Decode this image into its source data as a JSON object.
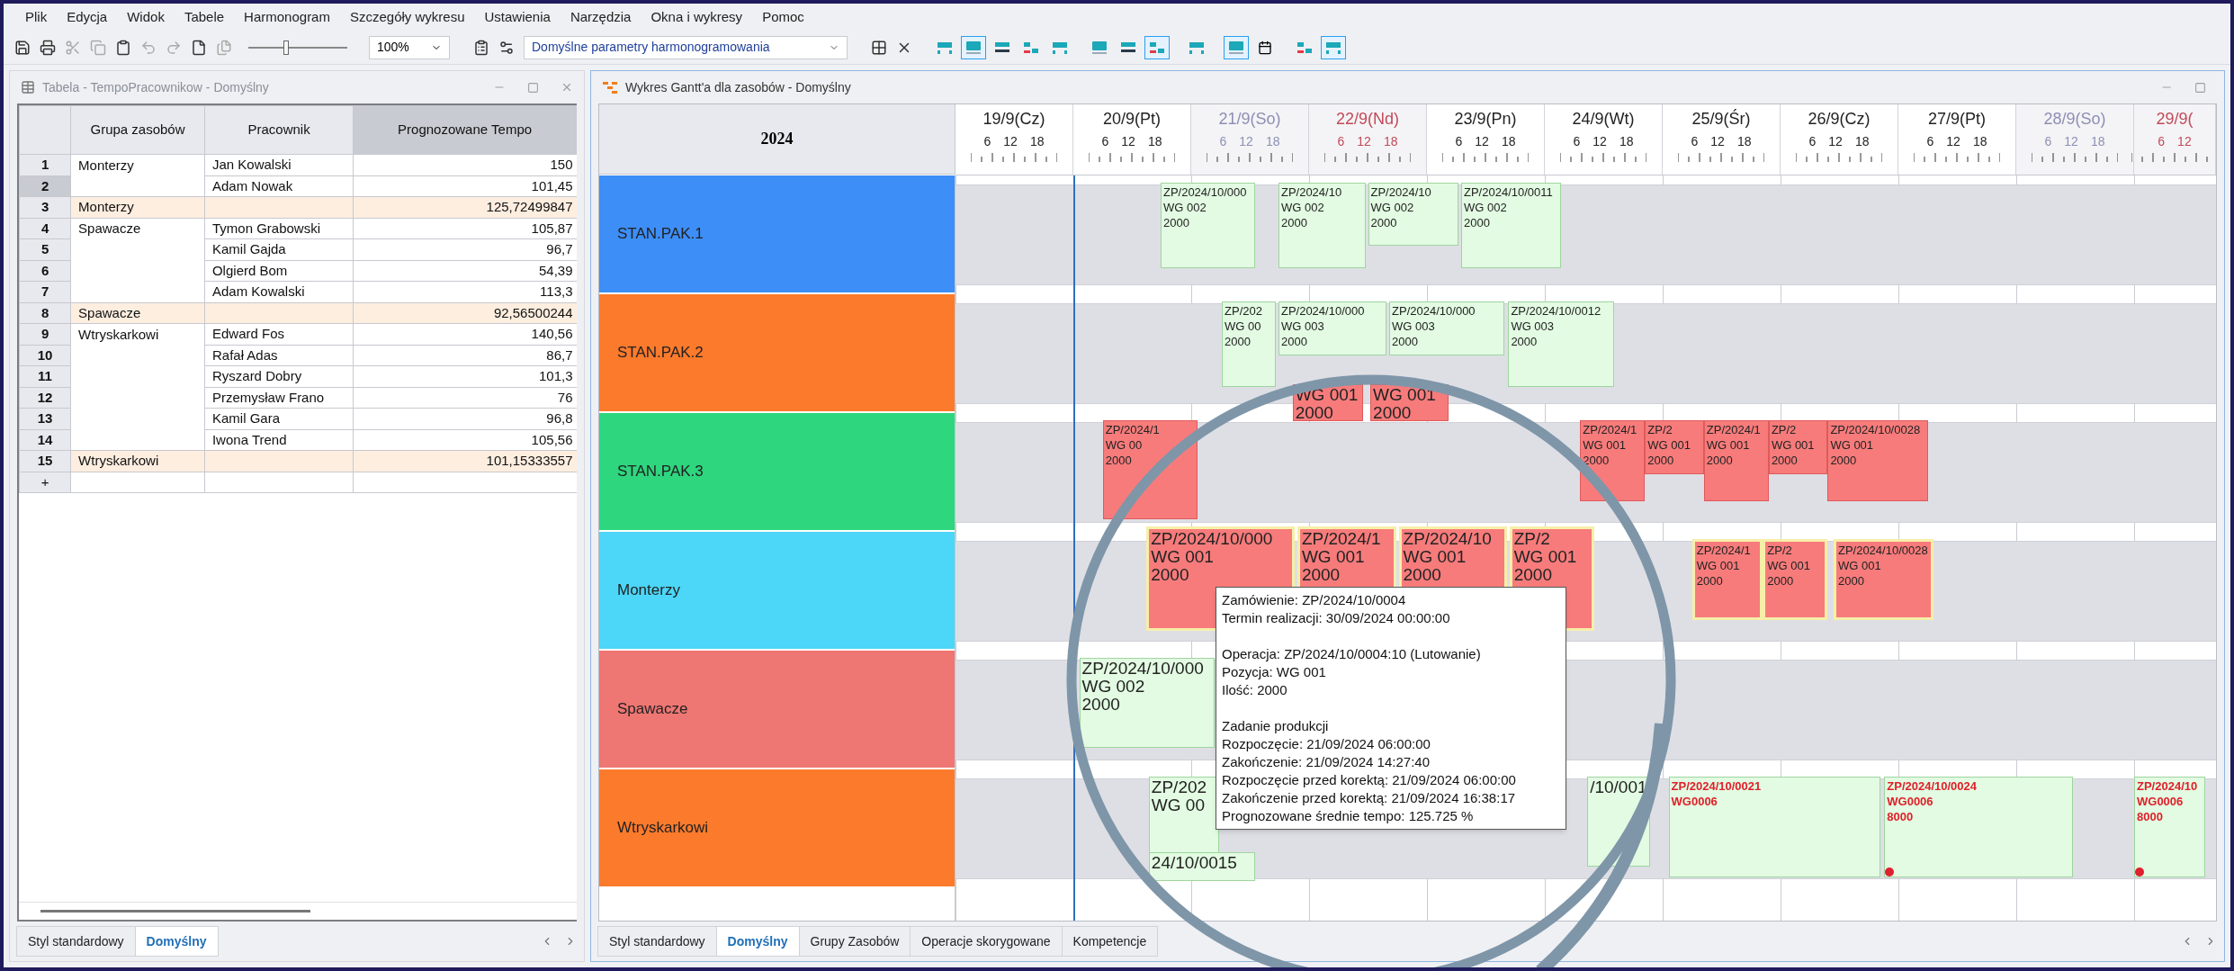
{
  "menu": [
    "Plik",
    "Edycja",
    "Widok",
    "Tabele",
    "Harmonogram",
    "Szczegóły wykresu",
    "Ustawienia",
    "Narzędzia",
    "Okna i wykresy",
    "Pomoc"
  ],
  "toolbar": {
    "zoom_slider": {
      "level": 0.35
    },
    "zoom": "100%",
    "profile": "Domyślne parametry harmonogramowania",
    "view_buttons": [
      {
        "selected": false
      },
      {
        "selected": true
      },
      {
        "selected": false
      },
      {
        "selected": false
      },
      {
        "selected": false
      },
      {
        "selected": false
      },
      {
        "selected": false
      },
      {
        "selected": true
      },
      {
        "selected": false
      },
      {
        "selected": true
      },
      {
        "selected": false
      },
      {
        "selected": false
      },
      {
        "selected": true
      }
    ]
  },
  "table_window": {
    "title": "Tabela - TempoPracownikow - Domyślny",
    "columns": [
      "Grupa zasobów",
      "Pracownik",
      "Prognozowane Tempo"
    ],
    "rows": [
      {
        "num": "1",
        "group": "Monterzy",
        "worker": "Jan Kowalski",
        "tempo": "150",
        "kind": "worker",
        "selected": false
      },
      {
        "num": "2",
        "worker": "Adam Nowak",
        "tempo": "101,45",
        "kind": "worker",
        "selected": true
      },
      {
        "num": "3",
        "group": "Monterzy",
        "tempo": "125,72499847",
        "kind": "summary",
        "selected": false
      },
      {
        "num": "4",
        "group": "Spawacze",
        "worker": "Tymon Grabowski",
        "tempo": "105,87",
        "kind": "worker",
        "selected": false
      },
      {
        "num": "5",
        "worker": "Kamil Gajda",
        "tempo": "96,7",
        "kind": "worker",
        "selected": false
      },
      {
        "num": "6",
        "worker": "Olgierd Bom",
        "tempo": "54,39",
        "kind": "worker",
        "selected": false
      },
      {
        "num": "7",
        "worker": "Adam Kowalski",
        "tempo": "113,3",
        "kind": "worker",
        "selected": false
      },
      {
        "num": "8",
        "group": "Spawacze",
        "tempo": "92,56500244",
        "kind": "summary",
        "selected": false
      },
      {
        "num": "9",
        "group": "Wtryskarkowi",
        "worker": "Edward Fos",
        "tempo": "140,56",
        "kind": "worker",
        "selected": false
      },
      {
        "num": "10",
        "worker": "Rafał Adas",
        "tempo": "86,7",
        "kind": "worker",
        "selected": false
      },
      {
        "num": "11",
        "worker": "Ryszard Dobry",
        "tempo": "101,3",
        "kind": "worker",
        "selected": false
      },
      {
        "num": "12",
        "worker": "Przemysław Frano",
        "tempo": "76",
        "kind": "worker",
        "selected": false
      },
      {
        "num": "13",
        "worker": "Kamil Gara",
        "tempo": "96,8",
        "kind": "worker",
        "selected": false
      },
      {
        "num": "14",
        "worker": "Iwona Trend",
        "tempo": "105,56",
        "kind": "worker",
        "selected": false
      },
      {
        "num": "15",
        "group": "Wtryskarkowi",
        "tempo": "101,15333557",
        "kind": "summary",
        "selected": false
      }
    ],
    "new_row": "+",
    "tabs": [
      {
        "label": "Styl standardowy",
        "selected": false
      },
      {
        "label": "Domyślny",
        "selected": true
      }
    ]
  },
  "gantt_window": {
    "title": "Wykres Gantt'a dla zasobów - Domyślny",
    "year": "2024",
    "days": [
      {
        "label": "19/9(Cz)",
        "kind": "weekday",
        "hours": [
          "6",
          "12",
          "18"
        ]
      },
      {
        "label": "20/9(Pt)",
        "kind": "weekday",
        "hours": [
          "6",
          "12",
          "18"
        ]
      },
      {
        "label": "21/9(So)",
        "kind": "saturday",
        "hours": [
          "6",
          "12",
          "18"
        ]
      },
      {
        "label": "22/9(Nd)",
        "kind": "sunday",
        "hours": [
          "6",
          "12",
          "18"
        ]
      },
      {
        "label": "23/9(Pn)",
        "kind": "weekday",
        "hours": [
          "6",
          "12",
          "18"
        ]
      },
      {
        "label": "24/9(Wt)",
        "kind": "weekday",
        "hours": [
          "6",
          "12",
          "18"
        ]
      },
      {
        "label": "25/9(Śr)",
        "kind": "weekday",
        "hours": [
          "6",
          "12",
          "18"
        ]
      },
      {
        "label": "26/9(Cz)",
        "kind": "weekday",
        "hours": [
          "6",
          "12",
          "18"
        ]
      },
      {
        "label": "27/9(Pt)",
        "kind": "weekday",
        "hours": [
          "6",
          "12",
          "18"
        ]
      },
      {
        "label": "28/9(So)",
        "kind": "saturday",
        "hours": [
          "6",
          "12",
          "18"
        ]
      },
      {
        "label": "29/9(",
        "kind": "sunday",
        "hours": [
          "6",
          "12"
        ]
      }
    ],
    "resources": [
      {
        "name": "STAN.PAK.1",
        "color": "#3d8ef7",
        "bars": [
          {
            "lines": [
              "ZP/2024/10/000",
              "WG 002",
              "2000"
            ],
            "kind": "plan",
            "magnified": false
          },
          {
            "lines": [
              "ZP/2024/10",
              "WG 002",
              "2000"
            ],
            "kind": "plan",
            "magnified": false
          },
          {
            "lines": [
              "ZP/2024/10",
              "WG 002",
              "2000"
            ],
            "kind": "plan",
            "magnified": false
          },
          {
            "lines": [
              "ZP/2024/10/0011",
              "WG 002",
              "2000"
            ],
            "kind": "plan",
            "magnified": false
          }
        ]
      },
      {
        "name": "STAN.PAK.2",
        "color": "#fc7a2b",
        "bars": [
          {
            "lines": [
              "ZP/202",
              "WG 00",
              "2000"
            ],
            "kind": "plan",
            "magnified": false
          },
          {
            "lines": [
              "ZP/2024/10/000",
              "WG 003",
              "2000"
            ],
            "kind": "plan",
            "magnified": false
          },
          {
            "lines": [
              "ZP/2024/10/000",
              "WG 003",
              "2000"
            ],
            "kind": "plan",
            "magnified": false
          },
          {
            "lines": [
              "ZP/2024/10/0012",
              "WG 003",
              "2000"
            ],
            "kind": "plan",
            "magnified": false
          },
          {
            "lines": [
              "WG 001",
              "2000"
            ],
            "kind": "late",
            "magnified": true
          },
          {
            "lines": [
              "WG 001",
              "2000"
            ],
            "kind": "late",
            "magnified": true
          }
        ]
      },
      {
        "name": "STAN.PAK.3",
        "color": "#2ed67e",
        "bars": [
          {
            "lines": [
              "ZP/2024/1",
              "WG 00",
              "2000"
            ],
            "kind": "late",
            "magnified": false
          },
          {
            "lines": [
              "ZP/2024/1",
              "WG 001",
              "2000"
            ],
            "kind": "late",
            "magnified": false
          },
          {
            "lines": [
              "ZP/2",
              "WG 001",
              "2000"
            ],
            "kind": "late",
            "magnified": false
          },
          {
            "lines": [
              "ZP/2024/1",
              "WG 001",
              "2000"
            ],
            "kind": "late",
            "magnified": false
          },
          {
            "lines": [
              "ZP/2",
              "WG 001",
              "2000"
            ],
            "kind": "late",
            "magnified": false
          },
          {
            "lines": [
              "ZP/2024/10/0028",
              "WG 001",
              "2000"
            ],
            "kind": "late",
            "magnified": false
          }
        ]
      },
      {
        "name": "Monterzy",
        "color": "#4cd6f7",
        "bars": [
          {
            "lines": [
              "ZP/2024/10/000",
              "WG 001",
              "2000"
            ],
            "kind": "late_selected",
            "magnified": true
          },
          {
            "lines": [
              "ZP/2024/1",
              "WG 001",
              "2000"
            ],
            "kind": "late_selected",
            "magnified": true
          },
          {
            "lines": [
              "ZP/2024/10",
              "WG 001",
              "2000"
            ],
            "kind": "late_selected",
            "magnified": true
          },
          {
            "lines": [
              "ZP/2",
              "WG 001",
              "2000"
            ],
            "kind": "late_selected",
            "magnified": true
          },
          {
            "lines": [
              "ZP/2024/1",
              "WG 001",
              "2000"
            ],
            "kind": "late_selected",
            "magnified": false
          },
          {
            "lines": [
              "ZP/2",
              "WG 001",
              "2000"
            ],
            "kind": "late_selected",
            "magnified": false
          },
          {
            "lines": [
              "ZP/2024/10/0028",
              "WG 001",
              "2000"
            ],
            "kind": "late_selected",
            "magnified": false
          }
        ]
      },
      {
        "name": "Spawacze",
        "color": "#ee7673",
        "bars": [
          {
            "lines": [
              "ZP/2024/10/000",
              "WG 002",
              "2000"
            ],
            "kind": "plan",
            "magnified": true
          }
        ]
      },
      {
        "name": "Wtryskarkowi",
        "color": "#fc7a2b",
        "bars": [
          {
            "lines": [
              "ZP/202",
              "WG 00"
            ],
            "kind": "plan",
            "magnified": true,
            "dot": false
          },
          {
            "lines": [
              "24/10/0015"
            ],
            "kind": "plan",
            "magnified": true,
            "dot": false
          },
          {
            "lines": [
              "/10/001"
            ],
            "kind": "plan",
            "magnified": true,
            "dot": false
          },
          {
            "lines": [
              "ZP/2024/10/0021",
              "WG0006"
            ],
            "kind": "alert",
            "magnified": false,
            "dot": false
          },
          {
            "lines": [
              "ZP/2024/10/0024",
              "WG0006",
              "8000"
            ],
            "kind": "alert",
            "magnified": false,
            "dot": true
          },
          {
            "lines": [
              "ZP/2024/10",
              "WG0006",
              "8000"
            ],
            "kind": "alert",
            "magnified": false,
            "dot": true
          }
        ]
      }
    ],
    "tooltip": {
      "sections": [
        [
          "Zamówienie: ZP/2024/10/0004",
          "Termin realizacji: 30/09/2024 00:00:00"
        ],
        [
          "Operacja: ZP/2024/10/0004:10 (Lutowanie)",
          "Pozycja: WG 001",
          "Ilość: 2000"
        ],
        [
          "Zadanie produkcji",
          "Rozpoczęcie: 21/09/2024 06:00:00",
          "Zakończenie: 21/09/2024 14:27:40",
          "Rozpoczęcie przed korektą: 21/09/2024 06:00:00",
          "Zakończenie przed korektą: 21/09/2024 16:38:17",
          "Prognozowane średnie tempo: 125.725 %"
        ]
      ]
    },
    "tabs": [
      {
        "label": "Styl standardowy",
        "selected": false
      },
      {
        "label": "Domyślny",
        "selected": true
      },
      {
        "label": "Grupy Zasobów",
        "selected": false
      },
      {
        "label": "Operacje skorygowane",
        "selected": false
      },
      {
        "label": "Kompetencje",
        "selected": false
      }
    ]
  }
}
